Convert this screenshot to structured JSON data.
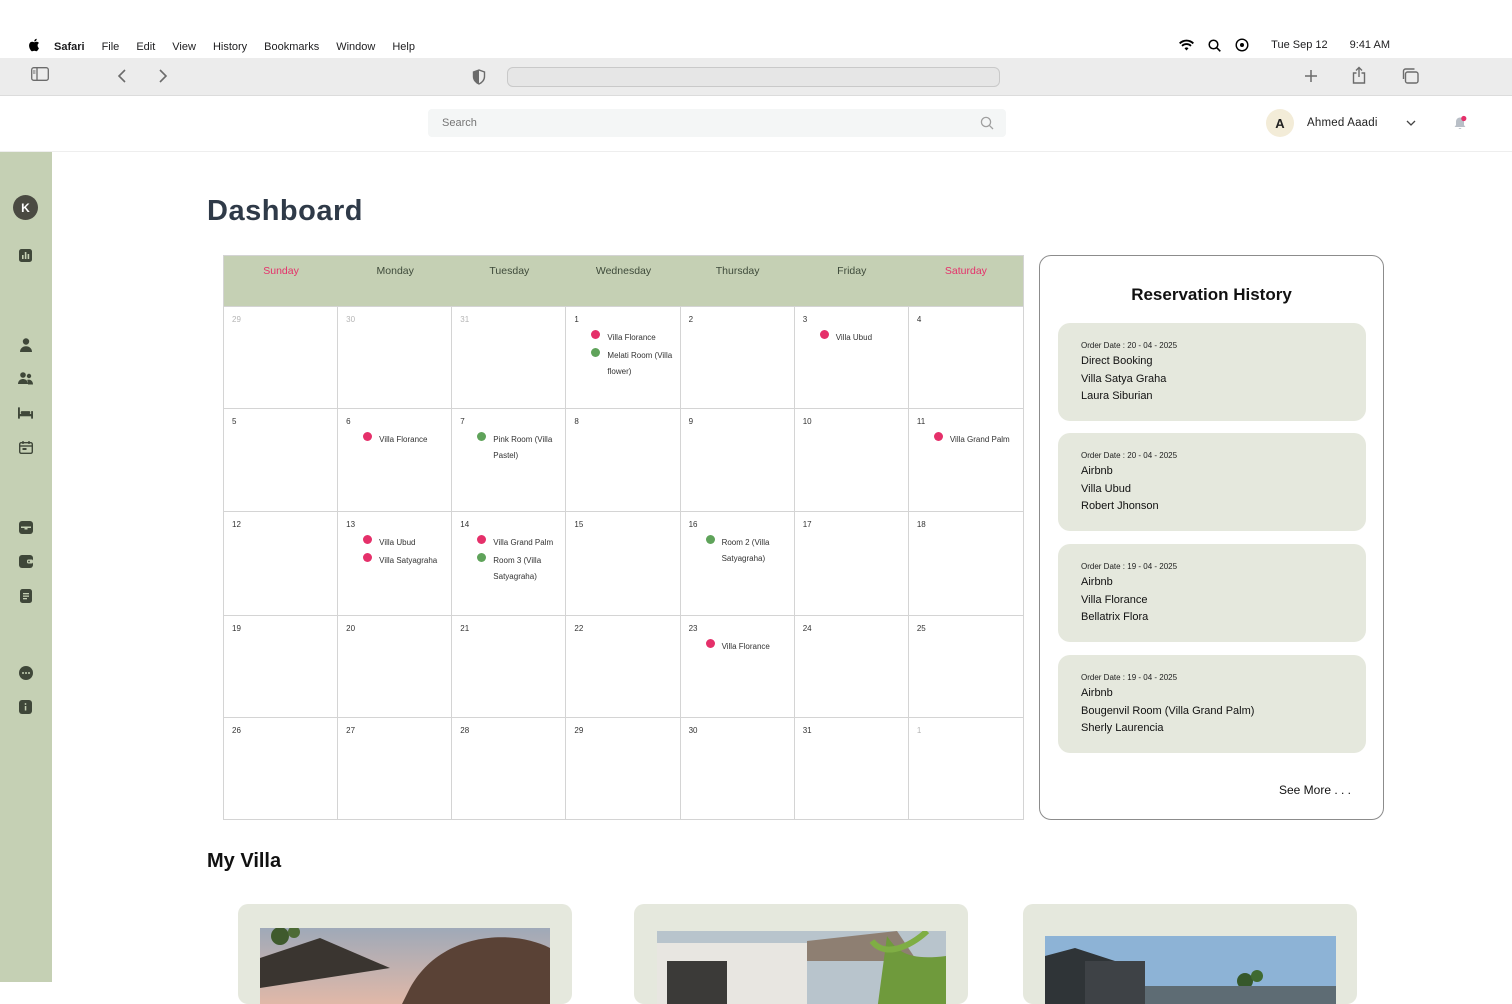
{
  "menubar": {
    "app": "Safari",
    "menus": [
      "File",
      "Edit",
      "View",
      "History",
      "Bookmarks",
      "Window",
      "Help"
    ],
    "date": "Tue Sep 12",
    "time": "9:41 AM"
  },
  "header": {
    "search_placeholder": "Search",
    "user_initial": "A",
    "user_name": "Ahmed Aaadi"
  },
  "sidebar": {
    "avatar_initial": "K"
  },
  "page": {
    "title": "Dashboard",
    "my_villa_title": "My Villa"
  },
  "calendar": {
    "days": [
      "Sunday",
      "Monday",
      "Tuesday",
      "Wednesday",
      "Thursday",
      "Friday",
      "Saturday"
    ],
    "cells": [
      {
        "d": "29",
        "muted": true,
        "events": []
      },
      {
        "d": "30",
        "muted": true,
        "events": []
      },
      {
        "d": "31",
        "muted": true,
        "events": []
      },
      {
        "d": "1",
        "events": [
          {
            "c": "pink",
            "t": "Villa Florance"
          },
          {
            "c": "green",
            "t": "Melati Room (Villa flower)"
          }
        ]
      },
      {
        "d": "2",
        "events": []
      },
      {
        "d": "3",
        "events": [
          {
            "c": "pink",
            "t": "Villa Ubud"
          }
        ]
      },
      {
        "d": "4",
        "events": []
      },
      {
        "d": "5",
        "events": []
      },
      {
        "d": "6",
        "events": [
          {
            "c": "pink",
            "t": "Villa Florance"
          }
        ]
      },
      {
        "d": "7",
        "events": [
          {
            "c": "green",
            "t": "Pink Room (Villa Pastel)"
          }
        ]
      },
      {
        "d": "8",
        "events": []
      },
      {
        "d": "9",
        "events": []
      },
      {
        "d": "10",
        "events": []
      },
      {
        "d": "11",
        "events": [
          {
            "c": "pink",
            "t": "Villa Grand Palm"
          }
        ]
      },
      {
        "d": "12",
        "events": []
      },
      {
        "d": "13",
        "events": [
          {
            "c": "pink",
            "t": "Villa Ubud"
          },
          {
            "c": "pink",
            "t": "Villa Satyagraha"
          }
        ]
      },
      {
        "d": "14",
        "events": [
          {
            "c": "pink",
            "t": "Villa Grand Palm"
          },
          {
            "c": "green",
            "t": "Room 3 (Villa Satyagraha)"
          }
        ]
      },
      {
        "d": "15",
        "events": []
      },
      {
        "d": "16",
        "events": [
          {
            "c": "green",
            "t": "Room 2 (Villa Satyagraha)"
          }
        ]
      },
      {
        "d": "17",
        "events": []
      },
      {
        "d": "18",
        "events": []
      },
      {
        "d": "19",
        "events": []
      },
      {
        "d": "20",
        "events": []
      },
      {
        "d": "21",
        "events": []
      },
      {
        "d": "22",
        "events": []
      },
      {
        "d": "23",
        "events": [
          {
            "c": "pink",
            "t": "Villa Florance"
          }
        ]
      },
      {
        "d": "24",
        "events": []
      },
      {
        "d": "25",
        "events": []
      },
      {
        "d": "26",
        "events": []
      },
      {
        "d": "27",
        "events": []
      },
      {
        "d": "28",
        "events": []
      },
      {
        "d": "29",
        "events": []
      },
      {
        "d": "30",
        "events": []
      },
      {
        "d": "31",
        "events": []
      },
      {
        "d": "1",
        "muted": true,
        "events": []
      }
    ]
  },
  "history": {
    "title": "Reservation History",
    "see_more": "See More . . .",
    "items": [
      {
        "date": "Order Date : 20 - 04 - 2025",
        "source": "Direct Booking",
        "villa": "Villa Satya Graha",
        "guest": "Laura Siburian"
      },
      {
        "date": "Order Date : 20 - 04 - 2025",
        "source": "Airbnb",
        "villa": "Villa Ubud",
        "guest": "Robert Jhonson"
      },
      {
        "date": "Order Date : 19 - 04 - 2025",
        "source": "Airbnb",
        "villa": "Villa Florance",
        "guest": "Bellatrix Flora"
      },
      {
        "date": "Order Date : 19 - 04 - 2025",
        "source": "Airbnb",
        "villa": "Bougenvil Room (Villa Grand Palm)",
        "guest": "Sherly Laurencia"
      }
    ]
  },
  "colors": {
    "sage": "#c5d0b4",
    "card": "#e5e8dd",
    "pink": "#e5306a",
    "green": "#5fa35a"
  }
}
